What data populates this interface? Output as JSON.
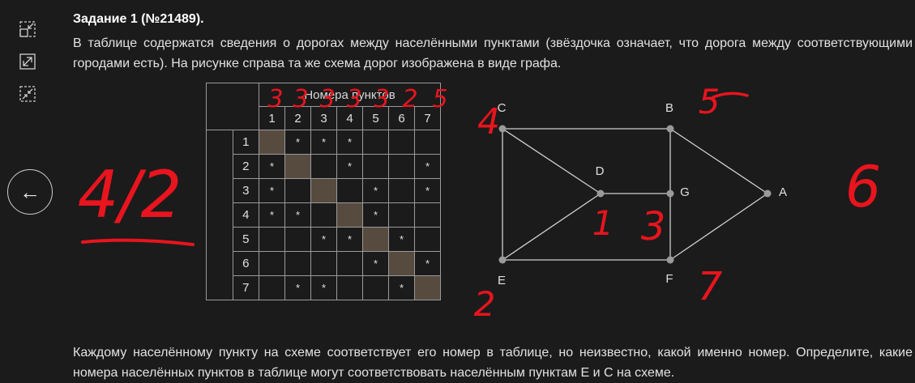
{
  "task": {
    "title": "Задание 1 (№21489).",
    "paragraph1": "В таблице содержатся сведения о дорогах между населёнными пунктами (звёздочка означает, что дорога между соответствующими городами есть). На рисунке справа та же схема дорог изображена в виде графа.",
    "paragraph2": "Каждому населённому пункту на схеме соответствует его номер в таблице, но неизвестно, какой именно номер. Определите, какие номера населённых пунктов в таблице могут соответствовать населённым пунктам E и C на схеме."
  },
  "sidebar": {
    "buttons": [
      {
        "icon": "collapse-icon"
      },
      {
        "icon": "expand-diagonal-icon"
      },
      {
        "icon": "shrink-diagonal-icon"
      }
    ],
    "back_label": "←"
  },
  "table": {
    "header_title": "Номера пунктов",
    "columns": [
      "1",
      "2",
      "3",
      "4",
      "5",
      "6",
      "7"
    ],
    "rows": [
      {
        "label": "1",
        "cells": [
          "",
          "*",
          "*",
          "*",
          "",
          "",
          ""
        ]
      },
      {
        "label": "2",
        "cells": [
          "*",
          "",
          "",
          "*",
          "",
          "",
          "*"
        ]
      },
      {
        "label": "3",
        "cells": [
          "*",
          "",
          "",
          "",
          "*",
          "",
          "*"
        ]
      },
      {
        "label": "4",
        "cells": [
          "*",
          "*",
          "",
          "",
          "*",
          "",
          ""
        ]
      },
      {
        "label": "5",
        "cells": [
          "",
          "",
          "*",
          "*",
          "",
          "*",
          ""
        ]
      },
      {
        "label": "6",
        "cells": [
          "",
          "",
          "",
          "",
          "*",
          "",
          "*"
        ]
      },
      {
        "label": "7",
        "cells": [
          "",
          "*",
          "*",
          "",
          "",
          "*",
          ""
        ]
      }
    ]
  },
  "graph": {
    "nodes": [
      "C",
      "B",
      "D",
      "G",
      "A",
      "E",
      "F"
    ],
    "edges": [
      [
        "C",
        "B"
      ],
      [
        "C",
        "D"
      ],
      [
        "C",
        "E"
      ],
      [
        "B",
        "G"
      ],
      [
        "B",
        "A"
      ],
      [
        "D",
        "G"
      ],
      [
        "D",
        "E"
      ],
      [
        "G",
        "F"
      ],
      [
        "E",
        "F"
      ],
      [
        "F",
        "A"
      ]
    ]
  },
  "annotations": {
    "color": "#e8141e",
    "top_row": [
      "3",
      "3",
      "3",
      "3",
      "3",
      "2",
      "5"
    ],
    "labels": [
      "4",
      "5",
      "6",
      "1",
      "3",
      "2",
      "7",
      "4/2"
    ]
  }
}
